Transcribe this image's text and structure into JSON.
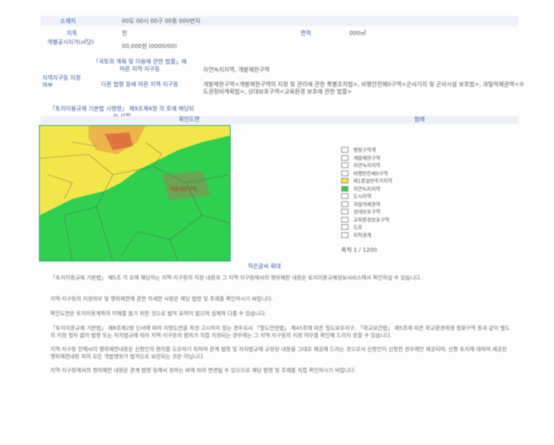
{
  "header": {
    "title_label": "소재지",
    "title_value": "00도 00시 00구 00동 000번지",
    "row2_label": "지목",
    "row2_value": "전",
    "row2_label2": "면적",
    "row2_value2": "000㎡",
    "row3_label": "개별공시지가(㎡당)",
    "row3_value": "00,000원 (0000/00)"
  },
  "zoning": {
    "section_label": "지역지구등 지정여부",
    "sub_labels": [
      "「국토의 계획 및 이용에 관한 법률」에 따른 지역·지구등",
      "다른 법령 등에 따른 지역·지구등"
    ],
    "values": [
      "자연녹지지역, 개발제한구역",
      "개발제한구역<개발제한구역의 지정 및 관리에 관한 특별조치법>, 비행안전제0구역<군사기지 및 군사시설 보호법>, 과밀억제권역<수도권정비계획법>, 상대보호구역<교육환경 보호에 관한 법률>"
    ],
    "footer_label": "「토지이용규제 기본법 시행령」 제9조제4항 각 호에 해당되는 사항"
  },
  "map": {
    "left_header": "확인도면",
    "right_header": "범례",
    "caption": "작은글씨 확대",
    "zone_label": "개발제한구역",
    "scale": "축척 1 / 1200",
    "legend": [
      {
        "label": "행정구역계",
        "color": "#ffffff"
      },
      {
        "label": "개발제한구역",
        "color": "#ffffff"
      },
      {
        "label": "자연녹지지역",
        "color": "#ffffff"
      },
      {
        "label": "비행안전제0구역",
        "color": "#ffffff"
      },
      {
        "label": "제1종일반주거지역",
        "color": "#f4e64a"
      },
      {
        "label": "자연녹지지역",
        "color": "#2fd050"
      },
      {
        "label": "도시지역",
        "color": "#ffffff"
      },
      {
        "label": "과밀억제권역",
        "color": "#ffffff"
      },
      {
        "label": "상대보호구역",
        "color": "#ffffff"
      },
      {
        "label": "교육환경보호구역",
        "color": "#ffffff"
      },
      {
        "label": "도로",
        "color": "#ffffff"
      },
      {
        "label": "지적경계",
        "color": "#ffffff"
      }
    ]
  },
  "notes": [
    "「토지이용규제 기본법」 제5조 각 호에 해당하는 지역·지구등의 지정 내용과 그 지역·지구등에서의 행위제한 내용은 토지이용규제정보서비스에서 확인하실 수 있습니다.",
    "지역·지구등의 지정여부 및 행위제한에 관한 자세한 사항은 해당 법령 및 조례를 확인하시기 바랍니다.",
    "확인도면은 토지이용계획의 이해를 돕기 위한 것으로 법적 효력이 없으며 실제와 다를 수 있습니다.",
    "「토지이용규제 기본법」 제8조제2항 단서에 따라 지형도면을 작성·고시하지 않는 경우로서 「철도안전법」 제45조에 따른 철도보호지구, 「학교보건법」 제5조에 따른 학교환경위생 정화구역 등과 같이 별도의 지정 절차 없이 법령 또는 자치법규에 따라 지역·지구등의 범위가 직접 지정되는 경우에는 그 지역·지구등의 지정 여부를 확인해 드리지 못할 수 있습니다.",
    "지역·지구등 안에서의 행위제한내용은 신청인의 편의를 도모하기 위하여 관계 법령 및 자치법규에 규정된 내용을 그대로 제공해 드리는 것으로서 신청인이 신청한 경우에만 제공되며, 신청 토지에 대하여 제공된 행위제한내용 외의 모든 개발행위가 법적으로 보장되는 것은 아닙니다.",
    "지역·지구등에서의 행위제한 내용은 관계 법령 등에서 정하는 바에 따라 변경될 수 있으므로 해당 법령 및 조례를 직접 확인하시기 바랍니다."
  ]
}
